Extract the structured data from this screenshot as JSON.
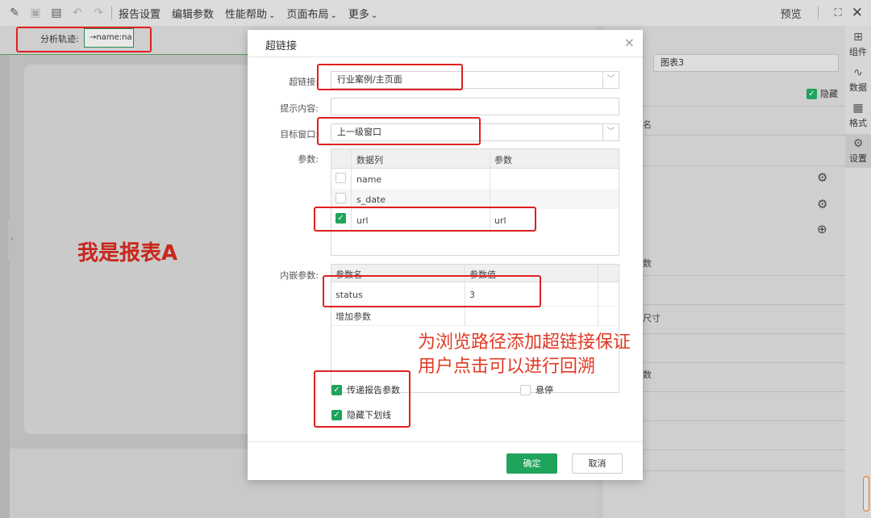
{
  "toolbar": {
    "items": [
      {
        "label": "报告设置",
        "has_menu": false
      },
      {
        "label": "编辑参数",
        "has_menu": false
      },
      {
        "label": "性能帮助",
        "has_menu": true
      },
      {
        "label": "页面布局",
        "has_menu": true
      },
      {
        "label": "更多",
        "has_menu": true
      }
    ],
    "preview": "预览",
    "chevron": "⌄"
  },
  "track": {
    "label": "分析轨迹:",
    "chip": "→name:na"
  },
  "canvas": {
    "report_title": "我是报表A"
  },
  "right_panel": {
    "name_value": "图表3",
    "hide_label": "隐藏",
    "fragments": [
      "名",
      "数",
      "尺寸",
      "数"
    ]
  },
  "side_tabs": [
    {
      "label": "组件",
      "icon": "component-icon"
    },
    {
      "label": "数据",
      "icon": "data-icon"
    },
    {
      "label": "格式",
      "icon": "format-icon"
    },
    {
      "label": "设置",
      "icon": "settings-icon"
    }
  ],
  "dialog": {
    "title": "超链接",
    "hyperlink_label": "超链接:",
    "hyperlink_value": "行业案例/主页面",
    "tip_label": "提示内容:",
    "tip_value": "",
    "target_label": "目标窗口:",
    "target_value": "上一级窗口",
    "params_label": "参数:",
    "params_table": {
      "headers": [
        "数据列",
        "参数"
      ],
      "rows": [
        {
          "column": "name",
          "param": "",
          "checked": false
        },
        {
          "column": "s_date",
          "param": "",
          "checked": false
        },
        {
          "column": "url",
          "param": "url",
          "checked": true
        }
      ]
    },
    "embed_label": "内嵌参数:",
    "embed_table": {
      "headers": [
        "参数名",
        "参数值"
      ],
      "rows": [
        {
          "name": "status",
          "value": "3"
        }
      ],
      "add_label": "增加参数"
    },
    "options": {
      "pass_params": "传递报告参数",
      "hide_underline": "隐藏下划线",
      "hover": "悬停"
    },
    "ok_label": "确定",
    "cancel_label": "取消"
  },
  "annotation": "为浏览路径添加超链接保证用户点击可以进行回溯",
  "colors": {
    "accent_green": "#1ea45b",
    "annotation_red": "#e23a25"
  }
}
